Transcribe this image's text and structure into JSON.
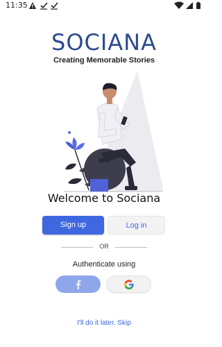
{
  "status_bar": {
    "time": "11:35",
    "left_icons": [
      "warning-icon",
      "download-check-icon",
      "download-check-icon"
    ],
    "right_icons": [
      "wifi-icon",
      "signal-icon",
      "battery-icon"
    ]
  },
  "brand": {
    "title": "SOCIANA",
    "tagline": "Creating Memorable Stories"
  },
  "welcome": "Welcome to Sociana",
  "buttons": {
    "signup": "Sign up",
    "login": "Log in"
  },
  "divider": "OR",
  "auth_label": "Authenticate using",
  "social": {
    "facebook_icon": "facebook-icon",
    "google_icon": "google-icon"
  },
  "skip": "I'll do it later. Skip",
  "colors": {
    "brand": "#2c4c8c",
    "primary": "#3f67e0",
    "facebook": "#8ea6ea",
    "link": "#3a63d8"
  }
}
